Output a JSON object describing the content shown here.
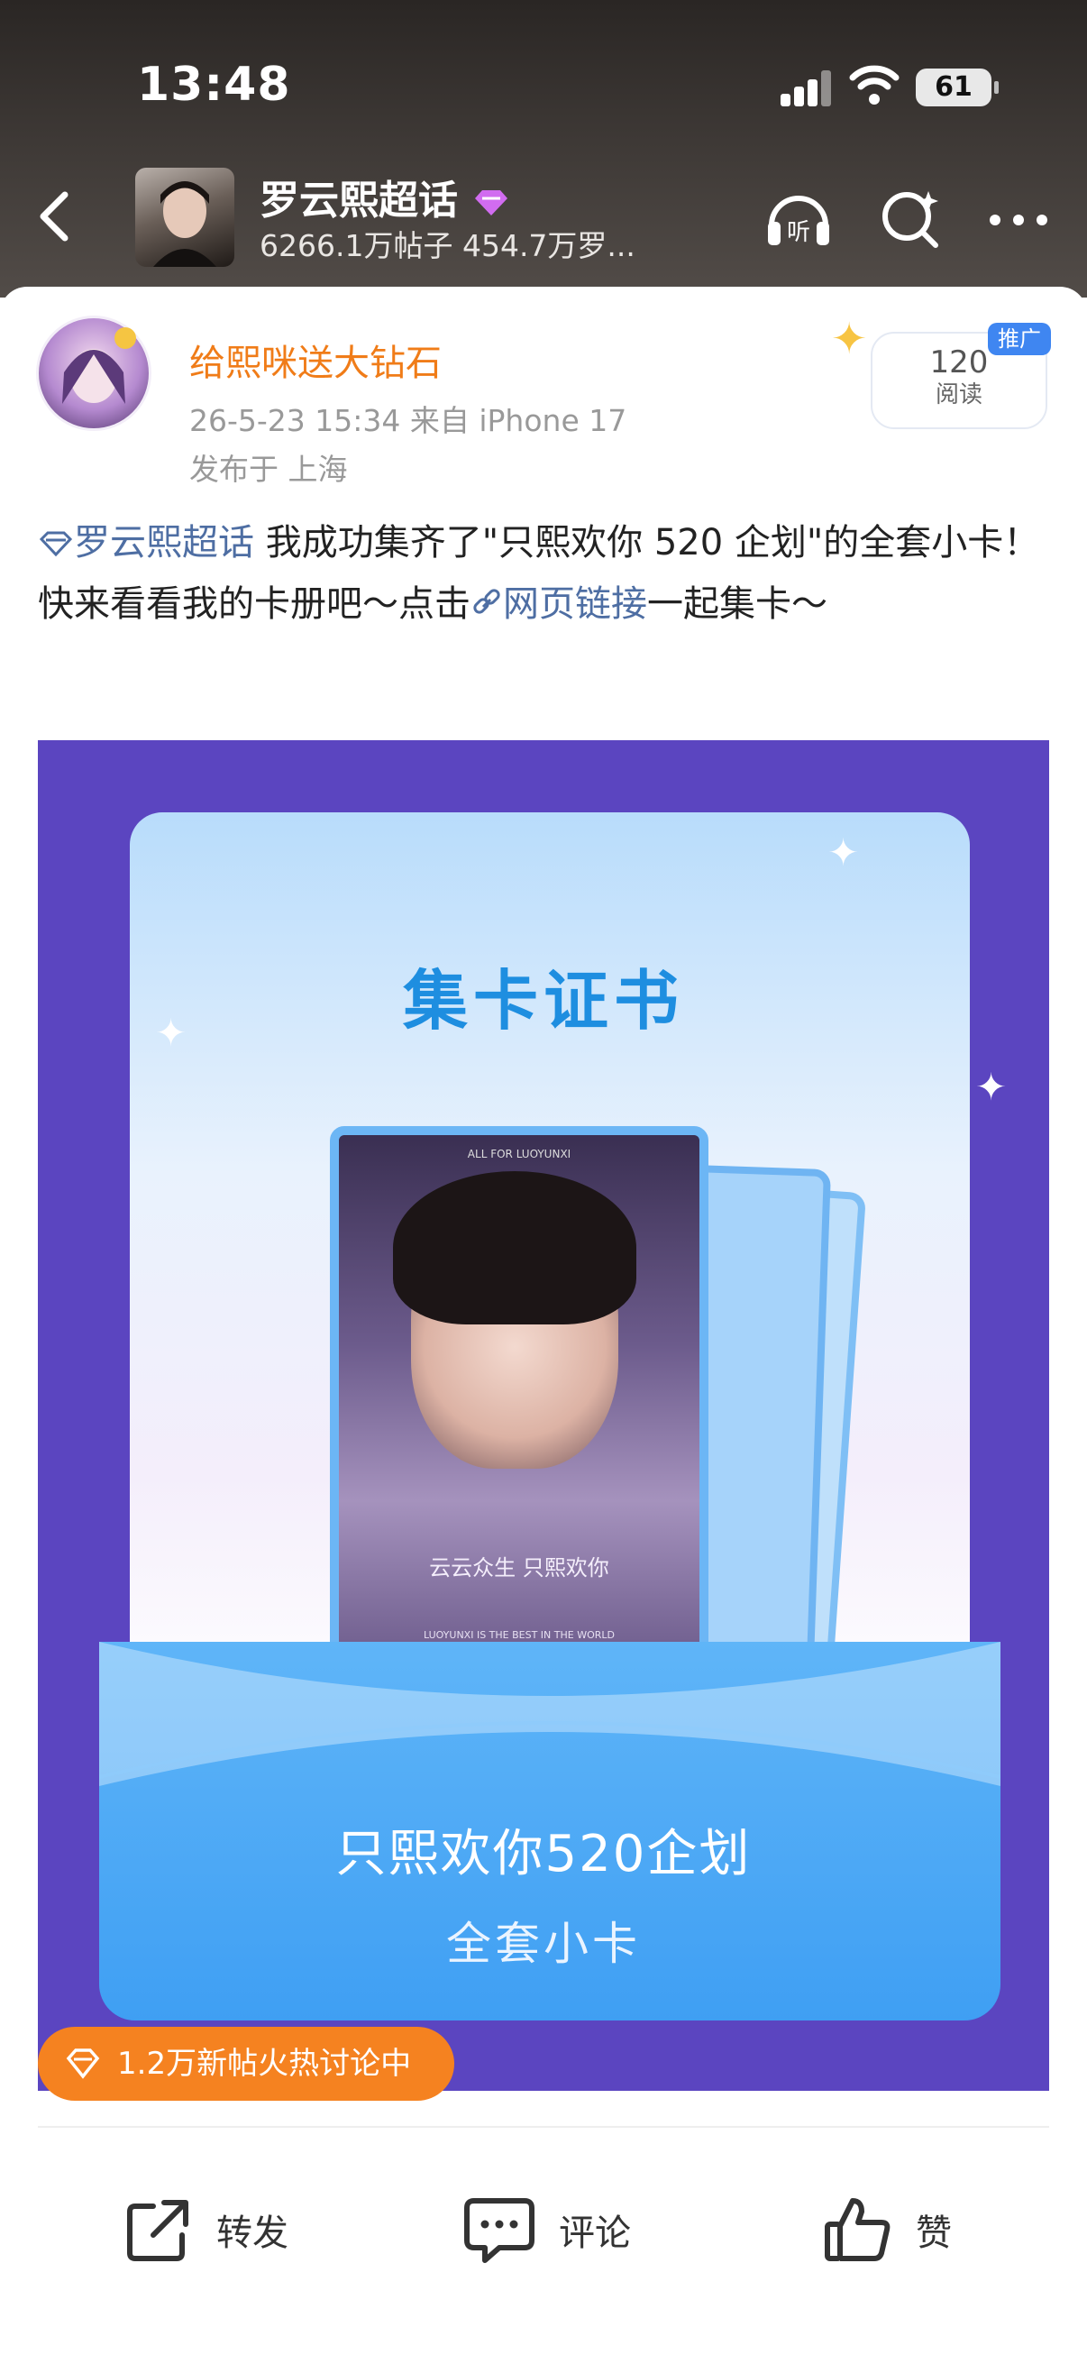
{
  "status_bar": {
    "time": "13:48",
    "battery": "61"
  },
  "nav": {
    "topic_title": "罗云熙超话",
    "topic_stats": "6266.1万帖子 454.7万罗...",
    "listen_label": "听"
  },
  "post": {
    "username": "给熙咪送大钻石",
    "time_device": "26-5-23 15:34  来自 iPhone 17",
    "location": "发布于 上海",
    "read_count": "120",
    "read_label": "阅读",
    "promo_tag": "推广",
    "topic_link": "罗云熙超话",
    "text_part1": " 我成功集齐了\"只熙欢你 520 企划\"的全套小卡！快来看看我的卡册吧～点击",
    "web_link": "网页链接",
    "text_part2": "一起集卡～"
  },
  "image": {
    "cert_title": "集卡证书",
    "photo_top": "ALL FOR LUOYUNXI",
    "photo_mid": "云云众生  只熙欢你",
    "photo_bot": "LUOYUNXI IS THE BEST IN THE WORLD",
    "env_line1": "只熙欢你520企划",
    "env_line2": "全套小卡"
  },
  "hot_badge": "1.2万新帖火热讨论中",
  "actions": {
    "repost": "转发",
    "comment": "评论",
    "like": "赞"
  }
}
